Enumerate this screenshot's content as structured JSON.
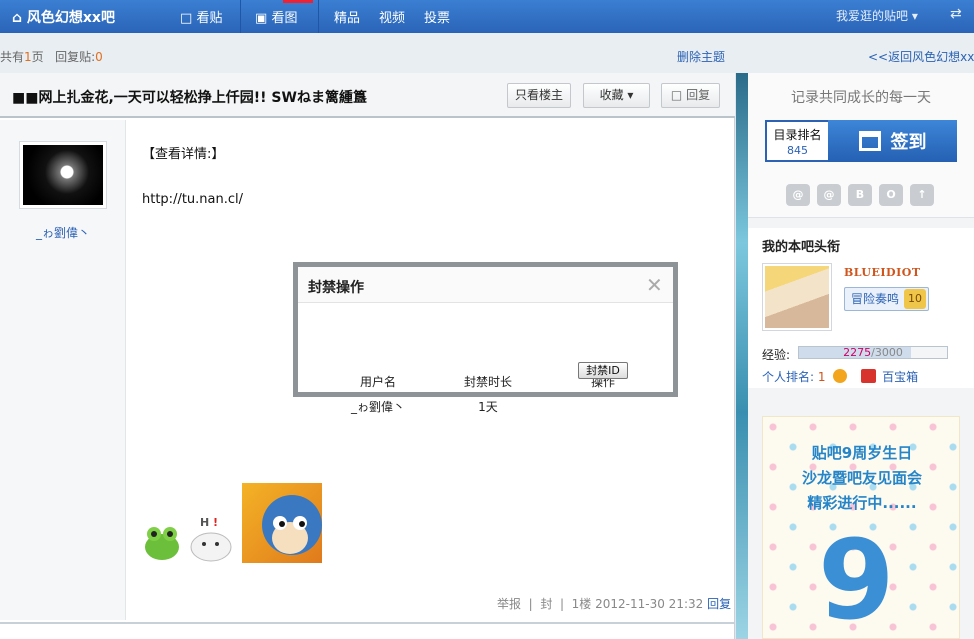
{
  "topbar": {
    "brand": "风色幻想xx吧",
    "nav": [
      "看贴",
      "看图",
      "精品",
      "视频",
      "投票"
    ],
    "favorite": "我爱逛的贴吧",
    "swap_icon": "swap-icon"
  },
  "subbar": {
    "pages_prefix": "共有",
    "pages_count": "1",
    "pages_suffix": "页",
    "replies_label": "回复贴:",
    "replies_count": "0",
    "delete_topic": "删除主题",
    "back_link": "<<返回风色幻想xx吧"
  },
  "post": {
    "title": "■■网上扎金花,一天可以轻松挣上仟园!! SWねま篱緟簋",
    "buttons": {
      "only_author": "只看楼主",
      "favorite": "收藏",
      "reply": "回复"
    },
    "username": "_ゎ劉偉丶",
    "content_heading": "【查看详情:】",
    "content_link": "http://tu.nan.cl/",
    "meta": {
      "report": "举报",
      "ban": "封",
      "floor": "1楼",
      "time": "2012-11-30 21:32",
      "reply": "回复"
    }
  },
  "sidebar": {
    "motto": "记录共同成长的每一天",
    "rank_label": "目录排名",
    "rank_value": "845",
    "sign_label": "签到",
    "icons": [
      "@",
      "@",
      "B",
      "O",
      "↑"
    ],
    "head_title": "我的本吧头衔",
    "head_name": "BLUEIDIOT",
    "level_name": "冒险奏鸣",
    "level_number": "10",
    "exp_label": "经验:",
    "exp_current": "2275",
    "exp_total": "3000",
    "exp_fraction": 0.7583,
    "rank_text": "个人排名:",
    "rank_num": "1",
    "treasure": "百宝箱",
    "promo": {
      "line1": "贴吧9周岁生日",
      "line2": "沙龙暨吧友见面会",
      "line3": "精彩进行中......",
      "big_number": "9"
    }
  },
  "modal": {
    "title": "封禁操作",
    "col_user": "用户名",
    "col_duration": "封禁时长",
    "col_action": "操作",
    "user_value": "_ゎ劉偉丶",
    "duration_value": "1天",
    "ban_button": "封禁ID"
  },
  "colors": {
    "nav_blue": "#2a64b8",
    "link_blue": "#2b62b5",
    "orange": "#e0701f"
  }
}
